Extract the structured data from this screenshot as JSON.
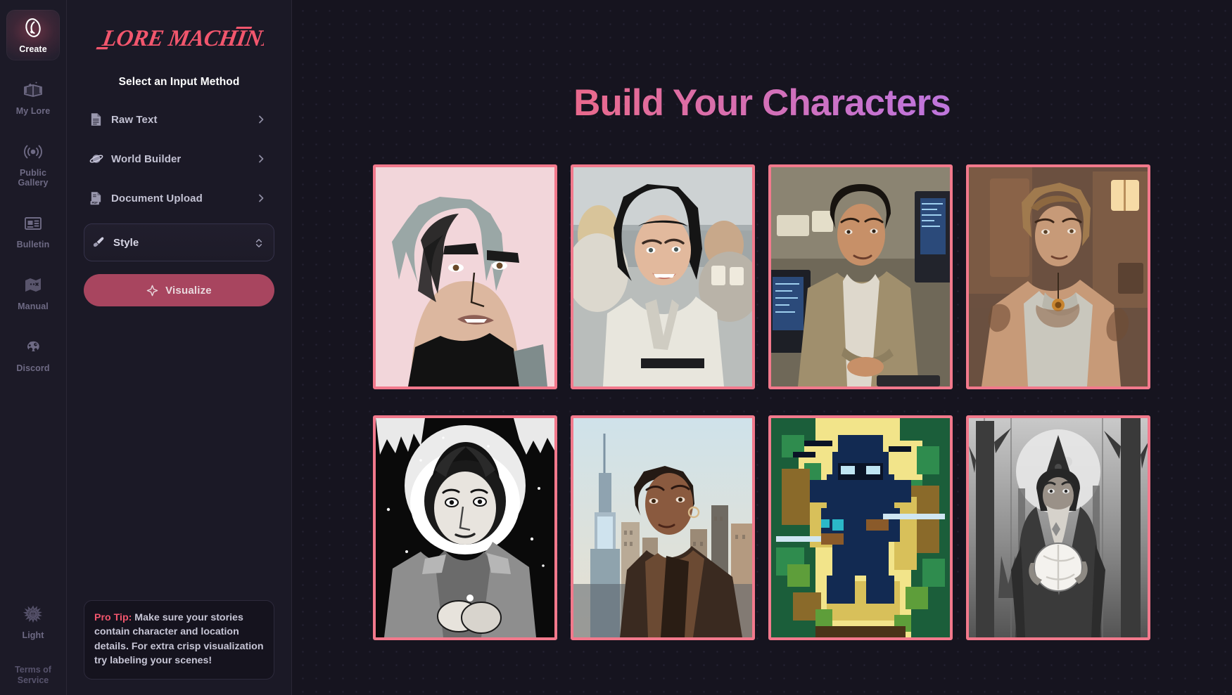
{
  "rail": {
    "items": [
      {
        "label": "Create",
        "icon": "lore-mark-icon",
        "active": true
      },
      {
        "label": "My Lore",
        "icon": "open-book-icon",
        "active": false
      },
      {
        "label": "Public Gallery",
        "icon": "broadcast-icon",
        "active": false
      },
      {
        "label": "Bulletin",
        "icon": "newspaper-icon",
        "active": false
      },
      {
        "label": "Manual",
        "icon": "map-icon",
        "active": false
      },
      {
        "label": "Discord",
        "icon": "discord-icon",
        "active": false
      }
    ],
    "theme_toggle": {
      "label": "Light",
      "icon": "sun-icon"
    },
    "terms": "Terms of Service"
  },
  "panel": {
    "logo_text": "LORE MACHINE",
    "title": "Select an Input Method",
    "methods": [
      {
        "label": "Raw Text",
        "icon": "document-text-icon",
        "chevron": "chevron-right-icon"
      },
      {
        "label": "World Builder",
        "icon": "planet-icon",
        "chevron": "chevron-right-icon"
      },
      {
        "label": "Document Upload",
        "icon": "pdf-file-icon",
        "chevron": "chevron-right-icon"
      }
    ],
    "style_selector": {
      "label": "Style",
      "icon": "paintbrush-icon",
      "chevron": "chevron-updown-icon"
    },
    "visualize_button": {
      "label": "Visualize",
      "icon": "sparkle-icon"
    },
    "pro_tip": {
      "keyword": "Pro Tip:",
      "text": " Make sure your stories contain character and location details. For extra crisp visualization try labeling your scenes!"
    }
  },
  "main": {
    "headline": "Build Your Characters",
    "gallery": [
      {
        "alt": "Comic-style man with spiky silver hair on pink background"
      },
      {
        "alt": "Smiling woman with dark hair in white blouse at outdoor cafe"
      },
      {
        "alt": "Young man in olive jacket at computer workstation"
      },
      {
        "alt": "3D rendered tattooed woman in tank top with pendant"
      },
      {
        "alt": "Ink drawing of curly-haired man in fur-hooded parka in snow"
      },
      {
        "alt": "Woman with short natural hair in leather jacket before NYC skyline"
      },
      {
        "alt": "Pixel-art ninja with twin blades in a jungle"
      },
      {
        "alt": "Greyscale wizard holding glowing orb in moonlit forest"
      }
    ]
  },
  "colors": {
    "accent_pink": "#f2566d",
    "card_border": "#f2798c",
    "button": "#a8455f",
    "bg": "#16141f",
    "panel_bg": "#1b1926"
  }
}
